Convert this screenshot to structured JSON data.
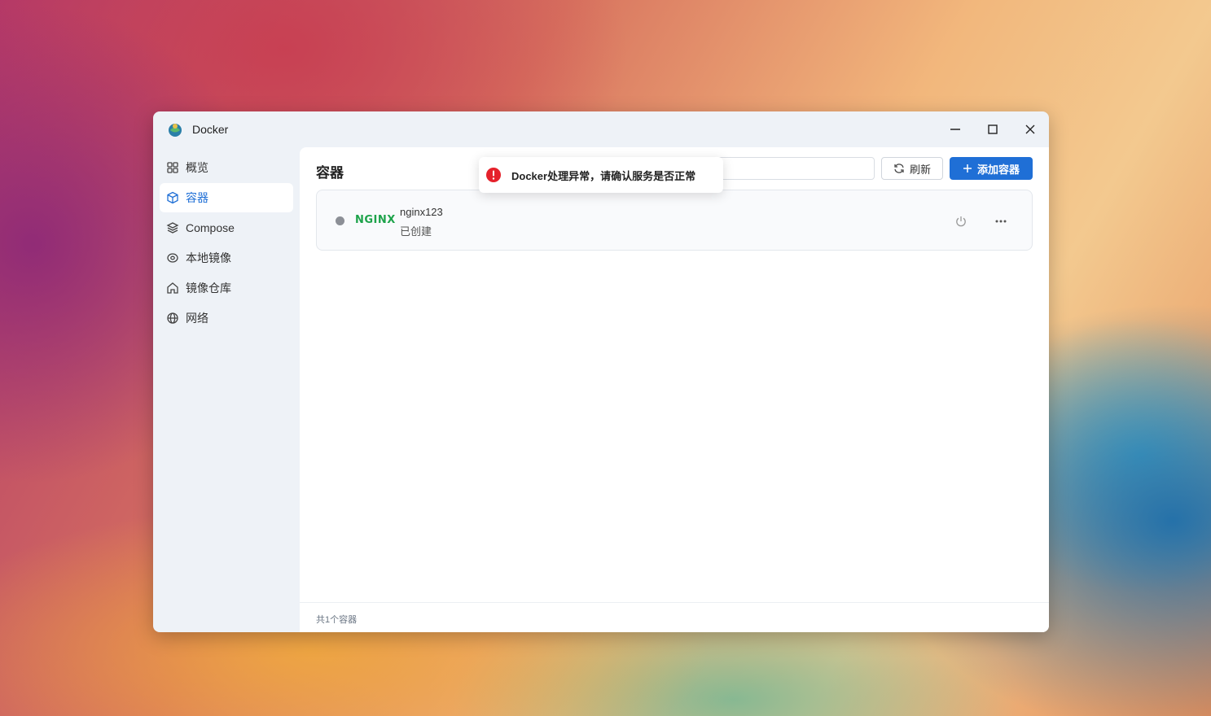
{
  "window": {
    "title": "Docker",
    "controls": {
      "minimize": "minimize-icon",
      "maximize": "maximize-icon",
      "close": "close-icon"
    }
  },
  "sidebar": {
    "items": [
      {
        "label": "概览",
        "icon": "grid-icon",
        "active": false
      },
      {
        "label": "容器",
        "icon": "cube-icon",
        "active": true
      },
      {
        "label": "Compose",
        "icon": "layers-icon",
        "active": false
      },
      {
        "label": "本地镜像",
        "icon": "disc-icon",
        "active": false
      },
      {
        "label": "镜像仓库",
        "icon": "home-icon",
        "active": false
      },
      {
        "label": "网络",
        "icon": "globe-icon",
        "active": false
      }
    ]
  },
  "main": {
    "title": "容器",
    "search": {
      "placeholder": ""
    },
    "refresh_label": "刷新",
    "add_label": "添加容器",
    "containers": [
      {
        "logo_text": "NGINX",
        "name": "nginx123",
        "status": "已创建",
        "status_color": "#8c8f96"
      }
    ],
    "footer": "共1个容器"
  },
  "toast": {
    "message": "Docker处理异常，请确认服务是否正常",
    "icon": "error-icon",
    "color": "#e5212b"
  },
  "colors": {
    "accent": "#1f6fd6",
    "nginx": "#1ea34b"
  }
}
